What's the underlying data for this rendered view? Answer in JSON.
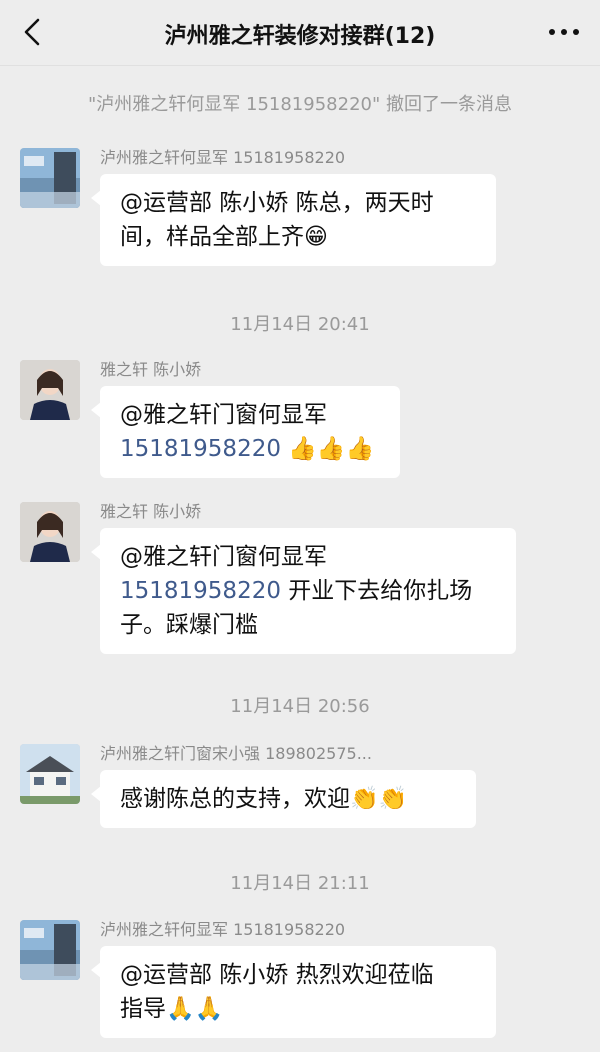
{
  "header": {
    "title": "泸州雅之轩装修对接群(12)"
  },
  "system": {
    "recall_notice": "\"泸州雅之轩何显军 15181958220\" 撤回了一条消息"
  },
  "timestamps": [
    "11月14日 20:41",
    "11月14日 20:56",
    "11月14日 21:11"
  ],
  "messages": [
    {
      "sender": "泸州雅之轩何显军 15181958220",
      "line1": "@运营部 陈小娇 陈总，两天时",
      "line2": "间，样品全部上齐",
      "emoji": "😁"
    },
    {
      "sender": "雅之轩 陈小娇",
      "line1": "@雅之轩门窗何显军",
      "phone": "15181958220",
      "emoji": "👍👍👍"
    },
    {
      "sender": "雅之轩 陈小娇",
      "line1": "@雅之轩门窗何显军",
      "phone": "15181958220",
      "line2_tail": " 开业下去给你扎场",
      "line3": "子。踩爆门槛"
    },
    {
      "sender": "泸州雅之轩门窗宋小强 189802575...",
      "line1": "感谢陈总的支持，欢迎",
      "emoji": "👏👏"
    },
    {
      "sender": "泸州雅之轩何显军 15181958220",
      "line1": "@运营部 陈小娇 热烈欢迎莅临",
      "line2": "指导",
      "emoji": "🙏🙏"
    }
  ],
  "colors": {
    "background": "#ededed",
    "bubble": "#ffffff",
    "link": "#3f5a8c",
    "meta_text": "#9a9a9a"
  },
  "icons": {
    "back": "chevron-left-icon",
    "more": "more-dots-icon"
  }
}
